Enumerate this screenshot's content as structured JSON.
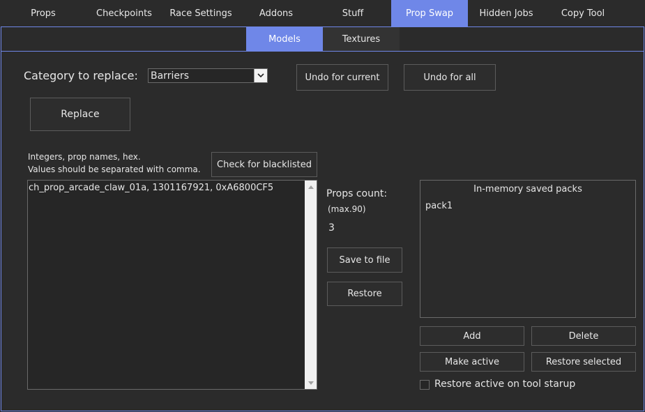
{
  "top_tabs": [
    {
      "label": "Props"
    },
    {
      "label": "Checkpoints"
    },
    {
      "label": "Race Settings"
    },
    {
      "label": "Addons"
    },
    {
      "label": "Stuff"
    },
    {
      "label": "Prop Swap"
    },
    {
      "label": "Hidden Jobs"
    },
    {
      "label": "Copy Tool"
    }
  ],
  "active_top_tab": "Prop Swap",
  "sub_tabs": [
    {
      "label": "Models"
    },
    {
      "label": "Textures"
    }
  ],
  "active_sub_tab": "Models",
  "category": {
    "label": "Category to replace:",
    "selected": "Barriers"
  },
  "buttons": {
    "undo_current": "Undo for current",
    "undo_all": "Undo for all",
    "replace": "Replace",
    "check_blacklisted": "Check for blacklisted",
    "save_to_file": "Save to file",
    "restore": "Restore",
    "add": "Add",
    "delete": "Delete",
    "make_active": "Make active",
    "restore_selected": "Restore selected"
  },
  "hint": {
    "line1": "Integers, prop names, hex.",
    "line2": "Values should be separated with comma."
  },
  "props_input": {
    "value": "ch_prop_arcade_claw_01a, 1301167921, 0xA6800CF5"
  },
  "props_count": {
    "label": "Props count:",
    "max_label": "(max.90)",
    "value": "3"
  },
  "packs": {
    "title": "In-memory saved packs",
    "items": [
      "pack1"
    ]
  },
  "restore_on_startup": {
    "label": "Restore active on tool starup",
    "checked": false
  },
  "colors": {
    "accent": "#6f87e8",
    "background": "#2b2b2b",
    "button_border": "#5c5c5c"
  }
}
